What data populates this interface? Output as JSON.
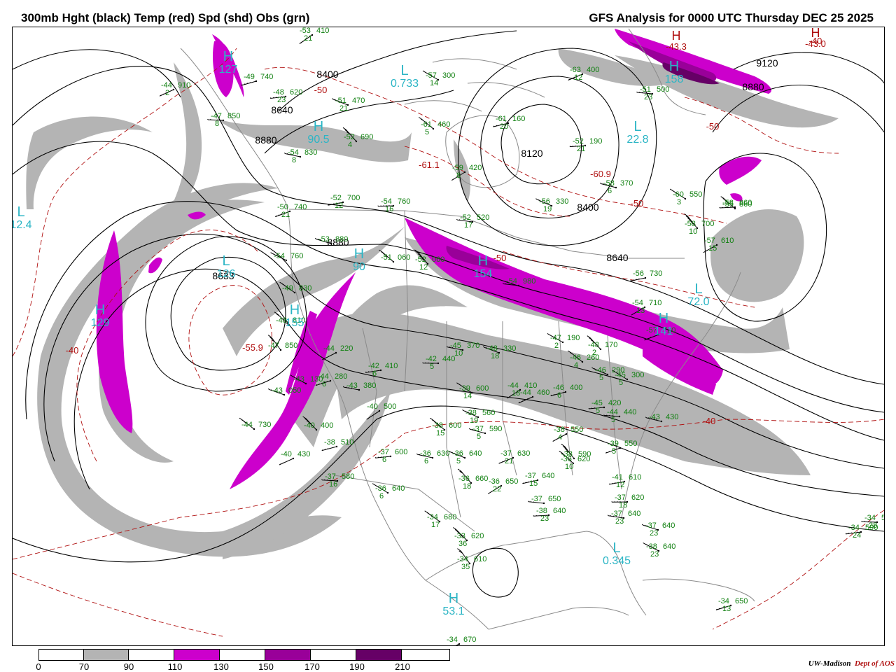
{
  "header": {
    "title_left": "300mb Hght (black) Temp (red) Spd (shd) Obs (grn)",
    "title_right": "GFS Analysis for 0000 UTC Thursday  DEC 25 2025"
  },
  "colors": {
    "height_contour": "#000000",
    "temperature_contour": "#b01010",
    "obs_text": "#108010",
    "marker_text": "#2bb5c5",
    "speed_70_90": "#b4b4b4",
    "speed_90_110": "#ffffff",
    "speed_110_130": "#cc00cc",
    "speed_130_150": "#ffffff",
    "speed_150_170": "#990099",
    "speed_170_190": "#ffffff",
    "speed_190_210": "#660066"
  },
  "pressure_markers": [
    {
      "letter": "H",
      "value": "127"
    },
    {
      "letter": "L",
      "value": "0.733"
    },
    {
      "letter": "H",
      "value": "129"
    },
    {
      "letter": "L",
      "value": "12.4"
    },
    {
      "letter": "L",
      "value": "126"
    },
    {
      "letter": "H",
      "value": "155"
    },
    {
      "letter": "H",
      "value": "90.5"
    },
    {
      "letter": "L",
      "value": "22.8"
    },
    {
      "letter": "H",
      "value": "158"
    },
    {
      "letter": "H",
      "value": "154"
    },
    {
      "letter": "L",
      "value": "72.0"
    },
    {
      "letter": "H",
      "value": "141"
    },
    {
      "letter": "L",
      "value": "0.345"
    },
    {
      "letter": "H",
      "value": "53.1"
    },
    {
      "letter": "H",
      "value": "90"
    }
  ],
  "warm_highs": [
    {
      "letter": "H",
      "value": "-43.3"
    },
    {
      "letter": "H",
      "value": "-43.0"
    }
  ],
  "height_labels": [
    "8400",
    "8640",
    "8880",
    "8120",
    "8400",
    "8640",
    "8880",
    "9120",
    "8633",
    "8880"
  ],
  "temperature_labels": [
    "-40",
    "-50",
    "-55.9",
    "-61.1",
    "-60.9",
    "-50",
    "-50",
    "-40",
    "-50",
    "-40"
  ],
  "observations": [
    {
      "t": "-53",
      "h": "410",
      "d": "21"
    },
    {
      "t": "-44",
      "h": "910",
      "d": "2"
    },
    {
      "t": "-49",
      "h": "740",
      "d": ""
    },
    {
      "t": "-48",
      "h": "620",
      "d": "23"
    },
    {
      "t": "-47",
      "h": "850",
      "d": "8"
    },
    {
      "t": "-54",
      "h": "830",
      "d": "8"
    },
    {
      "t": "-51",
      "h": "470",
      "d": "21"
    },
    {
      "t": "-57",
      "h": "300",
      "d": "14"
    },
    {
      "t": "-61",
      "h": "460",
      "d": "5"
    },
    {
      "t": "-52",
      "h": "690",
      "d": "4"
    },
    {
      "t": "-59",
      "h": "420",
      "d": "8"
    },
    {
      "t": "-63",
      "h": "400",
      "d": "12"
    },
    {
      "t": "-61",
      "h": "160",
      "d": "20"
    },
    {
      "t": "-52",
      "h": "190",
      "d": "21"
    },
    {
      "t": "-51",
      "h": "500",
      "d": "23"
    },
    {
      "t": "-58",
      "h": "370",
      "d": "6"
    },
    {
      "t": "-56",
      "h": "330",
      "d": "19"
    },
    {
      "t": "-60",
      "h": "550",
      "d": "3"
    },
    {
      "t": "-55",
      "h": "860",
      "d": ""
    },
    {
      "t": "-58",
      "h": "700",
      "d": "10"
    },
    {
      "t": "-57",
      "h": "610",
      "d": "15"
    },
    {
      "t": "-50",
      "h": "740",
      "d": "21"
    },
    {
      "t": "-52",
      "h": "700",
      "d": "12"
    },
    {
      "t": "-54",
      "h": "760",
      "d": "16"
    },
    {
      "t": "-52",
      "h": "520",
      "d": "17"
    },
    {
      "t": "-53",
      "h": "880",
      "d": ""
    },
    {
      "t": "-54",
      "h": "760",
      "d": ""
    },
    {
      "t": "-49",
      "h": "830",
      "d": ""
    },
    {
      "t": "-48",
      "h": "810",
      "d": ""
    },
    {
      "t": "-47",
      "h": "850",
      "d": ""
    },
    {
      "t": "-44",
      "h": "220",
      "d": ""
    },
    {
      "t": "-44",
      "h": "280",
      "d": "6"
    },
    {
      "t": "-42",
      "h": "410",
      "d": "6"
    },
    {
      "t": "-42",
      "h": "440",
      "d": "5"
    },
    {
      "t": "-43",
      "h": "380",
      "d": ""
    },
    {
      "t": "-43",
      "h": "050",
      "d": ""
    },
    {
      "t": "-43",
      "h": "130",
      "d": ""
    },
    {
      "t": "-44",
      "h": "730",
      "d": ""
    },
    {
      "t": "-40",
      "h": "400",
      "d": ""
    },
    {
      "t": "-40",
      "h": "500",
      "d": ""
    },
    {
      "t": "-40",
      "h": "430",
      "d": ""
    },
    {
      "t": "-38",
      "h": "510",
      "d": ""
    },
    {
      "t": "-37",
      "h": "600",
      "d": "6"
    },
    {
      "t": "-37",
      "h": "580",
      "d": "16"
    },
    {
      "t": "-36",
      "h": "630",
      "d": "6"
    },
    {
      "t": "-36",
      "h": "640",
      "d": "5"
    },
    {
      "t": "-36",
      "h": "640",
      "d": "6"
    },
    {
      "t": "-38",
      "h": "600",
      "d": "15"
    },
    {
      "t": "-36",
      "h": "660",
      "d": "18"
    },
    {
      "t": "-36",
      "h": "650",
      "d": "22"
    },
    {
      "t": "-37",
      "h": "630",
      "d": "21"
    },
    {
      "t": "-37",
      "h": "640",
      "d": "15"
    },
    {
      "t": "-38",
      "h": "640",
      "d": "23"
    },
    {
      "t": "-37",
      "h": "650",
      "d": ""
    },
    {
      "t": "-37",
      "h": "590",
      "d": "5"
    },
    {
      "t": "-38",
      "h": "560",
      "d": "19"
    },
    {
      "t": "-39",
      "h": "600",
      "d": "14"
    },
    {
      "t": "-36",
      "h": "620",
      "d": "10"
    },
    {
      "t": "-38",
      "h": "590",
      "d": ""
    },
    {
      "t": "-38",
      "h": "550",
      "d": "4"
    },
    {
      "t": "-39",
      "h": "550",
      "d": "5"
    },
    {
      "t": "-41",
      "h": "610",
      "d": "12"
    },
    {
      "t": "-37",
      "h": "620",
      "d": "18"
    },
    {
      "t": "-37",
      "h": "640",
      "d": "23"
    },
    {
      "t": "-37",
      "h": "640",
      "d": "23"
    },
    {
      "t": "-38",
      "h": "640",
      "d": "23"
    },
    {
      "t": "-34",
      "h": "680",
      "d": "17"
    },
    {
      "t": "-33",
      "h": "620",
      "d": "36"
    },
    {
      "t": "-34",
      "h": "610",
      "d": "35"
    },
    {
      "t": "-34",
      "h": "670",
      "d": ""
    },
    {
      "t": "-34",
      "h": "650",
      "d": "13"
    },
    {
      "t": "-34",
      "h": "590",
      "d": "24"
    },
    {
      "t": "-34",
      "h": "570",
      "d": "28"
    },
    {
      "t": "-45",
      "h": "370",
      "d": "10"
    },
    {
      "t": "-48",
      "h": "330",
      "d": "18"
    },
    {
      "t": "-47",
      "h": "190",
      "d": "2"
    },
    {
      "t": "-46",
      "h": "260",
      "d": "4"
    },
    {
      "t": "-48",
      "h": "170",
      "d": "2"
    },
    {
      "t": "-44",
      "h": "410",
      "d": "18"
    },
    {
      "t": "-44",
      "h": "460",
      "d": ""
    },
    {
      "t": "-46",
      "h": "400",
      "d": "6"
    },
    {
      "t": "-45",
      "h": "420",
      "d": "5"
    },
    {
      "t": "-44",
      "h": "440",
      "d": "5"
    },
    {
      "t": "-43",
      "h": "430",
      "d": ""
    },
    {
      "t": "-46",
      "h": "290",
      "d": "5"
    },
    {
      "t": "-45",
      "h": "300",
      "d": "5"
    },
    {
      "t": "-51",
      "h": "060",
      "d": ""
    },
    {
      "t": "-52",
      "h": "060",
      "d": "12"
    },
    {
      "t": "-54",
      "h": "710",
      "d": "13"
    },
    {
      "t": "-57",
      "h": "720",
      "d": ""
    },
    {
      "t": "-56",
      "h": "730",
      "d": ""
    },
    {
      "t": "-58",
      "h": "860",
      "d": ""
    },
    {
      "t": "-54",
      "h": "980",
      "d": ""
    }
  ],
  "legend": {
    "ticks": [
      "0",
      "70",
      "90",
      "110",
      "130",
      "150",
      "170",
      "190",
      "210"
    ]
  },
  "credit": {
    "org": "UW-Madison",
    "dept": "Dept of AOS"
  }
}
